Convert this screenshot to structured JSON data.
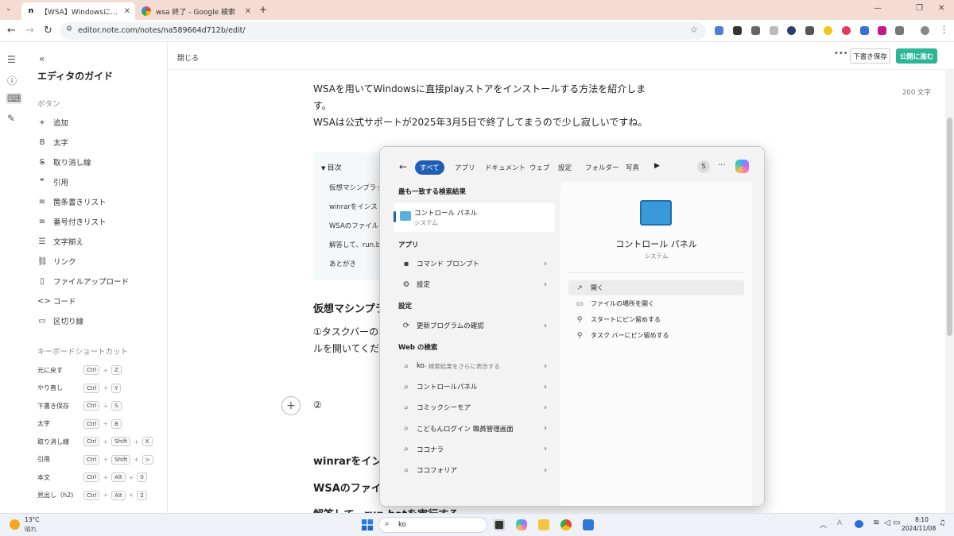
{
  "browser": {
    "tabs": [
      {
        "label": "【WSA】WindowsにPlayストアをイ...",
        "favicon": "note-favicon"
      },
      {
        "label": "wsa 終了 - Google 検索",
        "favicon": "google-favicon"
      }
    ],
    "url": "editor.note.com/notes/na589664d712b/edit/"
  },
  "guide": {
    "title": "エディタのガイド",
    "buttons_header": "ボタン",
    "buttons": [
      {
        "icon": "plus-icon",
        "glyph": "+",
        "label": "追加"
      },
      {
        "icon": "bold-icon",
        "glyph": "B",
        "label": "太字"
      },
      {
        "icon": "strikethrough-icon",
        "glyph": "S̶",
        "label": "取り消し線"
      },
      {
        "icon": "quote-icon",
        "glyph": "❞",
        "label": "引用"
      },
      {
        "icon": "bullet-list-icon",
        "glyph": "≡",
        "label": "箇条書きリスト"
      },
      {
        "icon": "numbered-list-icon",
        "glyph": "≡",
        "label": "番号付きリスト"
      },
      {
        "icon": "align-icon",
        "glyph": "☰",
        "label": "文字揃え"
      },
      {
        "icon": "link-icon",
        "glyph": "⛓",
        "label": "リンク"
      },
      {
        "icon": "file-upload-icon",
        "glyph": "▯",
        "label": "ファイルアップロード"
      },
      {
        "icon": "code-icon",
        "glyph": "<>",
        "label": "コード"
      },
      {
        "icon": "divider-icon",
        "glyph": "▭",
        "label": "区切り線"
      }
    ],
    "shortcuts_header": "キーボードショートカット",
    "shortcuts": [
      {
        "label": "元に戻す",
        "keys": [
          "Ctrl",
          "Z"
        ]
      },
      {
        "label": "やり直し",
        "keys": [
          "Ctrl",
          "Y"
        ]
      },
      {
        "label": "下書き保存",
        "keys": [
          "Ctrl",
          "S"
        ]
      },
      {
        "label": "太字",
        "keys": [
          "Ctrl",
          "B"
        ]
      },
      {
        "label": "取り消し線",
        "keys": [
          "Ctrl",
          "Shift",
          "X"
        ]
      },
      {
        "label": "引用",
        "keys": [
          "Ctrl",
          "Shift",
          ">"
        ]
      },
      {
        "label": "本文",
        "keys": [
          "Ctrl",
          "Alt",
          "0"
        ]
      },
      {
        "label": "見出し（h2)",
        "keys": [
          "Ctrl",
          "Alt",
          "2"
        ]
      }
    ]
  },
  "editor": {
    "close_label": "閉じる",
    "more_label": "•••",
    "draft_label": "下書き保存",
    "publish_label": "公開に進む",
    "char_count": "200 文字",
    "intro_line1": "WSAを用いてWindowsに直接playストアをインストールする方法を紹介しま",
    "intro_line2": "す。",
    "intro_line3": "WSAは公式サポートが2025年3月5日で終了してまうので少し寂しいですね。",
    "toc_title": "目次",
    "toc_items": [
      "仮想マシンプラットフ",
      "winrarをインストー",
      "WSAのファイルをダ",
      "解答して、run.bat",
      "あとがき"
    ],
    "h_vm": "仮想マシンプラ",
    "step1_line1": "①タスクバーの検",
    "step1_line2": "ルを開いてくださ",
    "step2": "②",
    "h_winrar": "winrarをインス",
    "h_wsa": "WSAのファイル",
    "h_extract": "解答して、run.batを実行する"
  },
  "search": {
    "filters": [
      "すべて",
      "アプリ",
      "ドキュメント",
      "ウェブ",
      "設定",
      "フォルダー",
      "写真"
    ],
    "avatar": "S",
    "best_match_header": "最も一致する検索結果",
    "best_match": {
      "title": "コントロール パネル",
      "sub": "システム"
    },
    "apps_header": "アプリ",
    "apps": [
      {
        "icon": "command-prompt-icon",
        "label": "コマンド プロンプト"
      },
      {
        "icon": "settings-icon",
        "label": "設定"
      }
    ],
    "settings_header": "設定",
    "settings": [
      {
        "icon": "refresh-icon",
        "label": "更新プログラムの確認"
      }
    ],
    "web_header": "Web の検索",
    "web": [
      {
        "label": "ko",
        "hint": " - 検索結果をさらに表示する"
      },
      {
        "label": "コントロールパネル",
        "hint": ""
      },
      {
        "label": "コミックシーモア",
        "hint": ""
      },
      {
        "label": "こどもんログイン 職員管理画面",
        "hint": ""
      },
      {
        "label": "ココナラ",
        "hint": ""
      },
      {
        "label": "ココフォリア",
        "hint": ""
      }
    ],
    "preview": {
      "title": "コントロール パネル",
      "sub": "システム",
      "actions": [
        {
          "icon": "open-icon",
          "label": "開く"
        },
        {
          "icon": "folder-icon",
          "label": "ファイルの場所を開く"
        },
        {
          "icon": "pin-icon",
          "label": "スタートにピン留めする"
        },
        {
          "icon": "pin-icon",
          "label": "タスク バーにピン留めする"
        }
      ]
    }
  },
  "taskbar": {
    "weather_temp": "13°C",
    "weather_desc": "晴れ",
    "search_value": "ko",
    "time": "8:10",
    "date": "2024/11/08"
  },
  "colors": {
    "accent": "#1f5fb3",
    "publish": "#2cb696",
    "tabbar": "#f4dcd2"
  }
}
